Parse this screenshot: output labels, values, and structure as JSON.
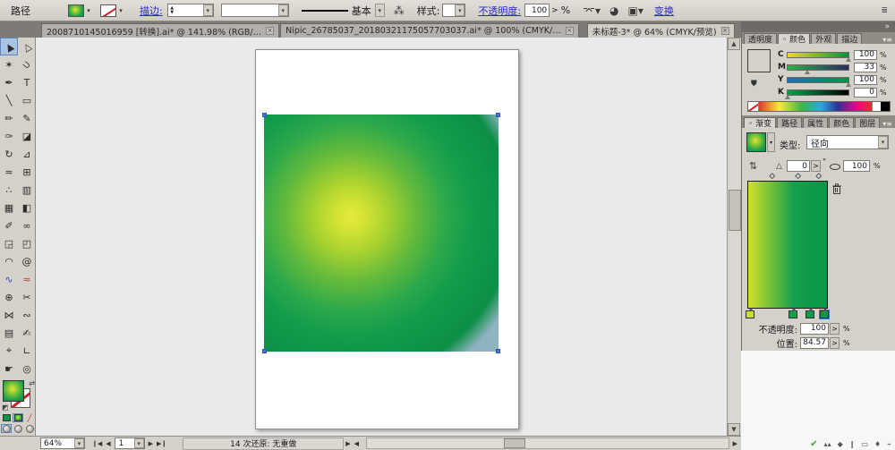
{
  "control_bar": {
    "selection_label": "路径",
    "stroke_label": "描边:",
    "brush_def": "基本",
    "style_label": "样式:",
    "opacity_label": "不透明度:",
    "opacity_value": "100",
    "percent": "%",
    "popup_arrow": ">",
    "transform_label": "变换",
    "menu_icon_glyph": "≣"
  },
  "document_tabs": [
    {
      "label": "2008710145016959 [转换].ai* @ 141.98% (RGB/…",
      "active": false
    },
    {
      "label": "Nipic_26785037_20180321175057703037.ai* @ 100% (CMYK/…",
      "active": false
    },
    {
      "label": "未标题-3* @ 64% (CMYK/预览)",
      "active": true
    }
  ],
  "close_glyph": "×",
  "dock_collapse_glyph": "»",
  "panel_menu_glyph": "▾≡",
  "toolbar": {
    "tools": [
      {
        "name": "selection-tool",
        "glyph": "▲",
        "rot": -30,
        "active": true
      },
      {
        "name": "direct-selection-tool",
        "glyph": "△",
        "rot": -30
      },
      {
        "name": "magic-wand-tool",
        "glyph": "✶"
      },
      {
        "name": "lasso-tool",
        "glyph": "⊃",
        "rot": 40
      },
      {
        "name": "pen-tool",
        "glyph": "✒"
      },
      {
        "name": "type-tool",
        "glyph": "T"
      },
      {
        "name": "line-segment-tool",
        "glyph": "╲"
      },
      {
        "name": "rectangle-tool",
        "glyph": "▭"
      },
      {
        "name": "paintbrush-tool",
        "glyph": "✏"
      },
      {
        "name": "pencil-tool",
        "glyph": "✎"
      },
      {
        "name": "blob-brush-tool",
        "glyph": "✑"
      },
      {
        "name": "eraser-tool",
        "glyph": "◪"
      },
      {
        "name": "rotate-tool",
        "glyph": "↻"
      },
      {
        "name": "scale-tool",
        "glyph": "⊿"
      },
      {
        "name": "width-tool",
        "glyph": "≈"
      },
      {
        "name": "free-transform-tool",
        "glyph": "⊞"
      },
      {
        "name": "symbol-sprayer-tool",
        "glyph": "∴"
      },
      {
        "name": "column-graph-tool",
        "glyph": "▥"
      },
      {
        "name": "mesh-tool",
        "glyph": "▦"
      },
      {
        "name": "gradient-tool",
        "glyph": "◧"
      },
      {
        "name": "eyedropper-tool",
        "glyph": "✐"
      },
      {
        "name": "blend-tool",
        "glyph": "∞"
      },
      {
        "name": "live-paint-bucket-tool",
        "glyph": "◲"
      },
      {
        "name": "live-paint-selection-tool",
        "glyph": "◰"
      },
      {
        "name": "arc-tool",
        "glyph": "◠"
      },
      {
        "name": "spiral-tool",
        "glyph": "@"
      },
      {
        "name": "line-graph-tool",
        "glyph": "∿",
        "color": "#2a4fc0"
      },
      {
        "name": "wave-tool",
        "glyph": "≈",
        "color": "#c03a2a"
      },
      {
        "name": "artboard-tool",
        "glyph": "⊕"
      },
      {
        "name": "slice-tool",
        "glyph": "✂"
      },
      {
        "name": "warp-tool",
        "glyph": "⋈"
      },
      {
        "name": "wrinkle-tool",
        "glyph": "∾"
      },
      {
        "name": "grid-tool",
        "glyph": "▤"
      },
      {
        "name": "shape-builder-tool",
        "glyph": "✍"
      },
      {
        "name": "measure-tool",
        "glyph": "⌖"
      },
      {
        "name": "ruler-tool",
        "glyph": "∟"
      },
      {
        "name": "hand-tool",
        "glyph": "☛"
      },
      {
        "name": "zoom-tool",
        "glyph": "◎"
      }
    ],
    "swap_glyph": "⇄",
    "mini_swatch_glyph": "◩",
    "none_glyph": "╱"
  },
  "color_panel": {
    "tabs": [
      {
        "label": "透明度",
        "active": false
      },
      {
        "label": "颜色",
        "active": true
      },
      {
        "label": "外观",
        "active": false
      },
      {
        "label": "描边",
        "active": false
      }
    ],
    "channels": [
      {
        "label": "C",
        "value": "100",
        "pos": 100,
        "track": [
          "#f0d915",
          "#00963f"
        ]
      },
      {
        "label": "M",
        "value": "33",
        "pos": 33,
        "track": [
          "#2fae4a",
          "#2b2b60"
        ]
      },
      {
        "label": "Y",
        "value": "100",
        "pos": 100,
        "track": [
          "#1e6fb5",
          "#00963f"
        ]
      },
      {
        "label": "K",
        "value": "0",
        "pos": 0,
        "track": [
          "#00a44c",
          "#000000"
        ]
      }
    ],
    "percent": "%"
  },
  "gradient_panel": {
    "tabs": [
      {
        "label": "渐变",
        "active": true
      },
      {
        "label": "路径",
        "active": false
      },
      {
        "label": "属性",
        "active": false
      },
      {
        "label": "颜色",
        "active": false
      },
      {
        "label": "图层",
        "active": false
      }
    ],
    "type_label": "类型:",
    "type_value": "径向",
    "reverse_glyph": "⇅",
    "angle_glyph": "△",
    "angle_value": "0",
    "degree": "°",
    "aspect_value": "100",
    "percent": "%",
    "popup_arrow": ">",
    "midpoints": [
      30,
      62,
      88
    ],
    "stops": [
      {
        "pos": 3,
        "color": "#c9dd2a",
        "selected": false
      },
      {
        "pos": 57,
        "color": "#17a04c",
        "selected": false
      },
      {
        "pos": 78,
        "color": "#0f9a4a",
        "selected": false
      },
      {
        "pos": 96,
        "color": "#0d9748",
        "selected": true
      }
    ],
    "opacity_label": "不透明度:",
    "opacity_value": "100",
    "position_label": "位置:",
    "position_value": "84.57"
  },
  "canvas": {
    "object_base_color": "#8fb3c0",
    "object_gradient_stops": [
      "#e5ea3e 0%",
      "#d3e335 8%",
      "#a8d22f 20%",
      "#63ba3c 36%",
      "#2ba84b 52%",
      "#129c4b 66%",
      "#0e9449 80%",
      "#0c8f46 88%",
      "rgba(12,143,70,0) 98%"
    ],
    "thumb_gradient_stops": [
      "#e0e636 0%",
      "#7cc437 35%",
      "#18a04c 70%, #0c8f46 100%"
    ]
  },
  "status_bar": {
    "zoom_value": "64%",
    "artboard_value": "1",
    "undo_status": "14 次还原: 无重做"
  },
  "colors": {
    "accent_blue_link": "#2929cc",
    "selection_handle": "#4a77d8",
    "swatch_green": "#0f9448"
  }
}
